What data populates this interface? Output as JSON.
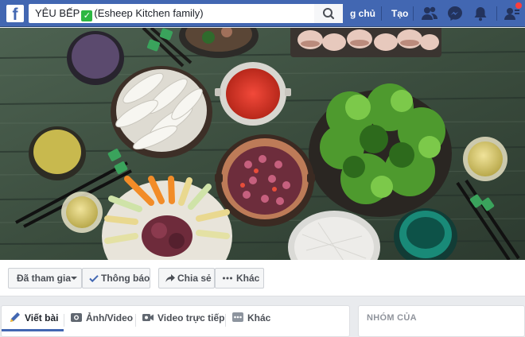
{
  "topbar": {
    "search_value_part1": "YÊU BẾP",
    "search_check": "✓",
    "search_value_part2": "(Esheep Kitchen family)",
    "home_label": "g chủ",
    "create_label": "Tạo"
  },
  "actions": {
    "joined_label": "Đã tham gia",
    "notifications_label": "Thông báo",
    "share_label": "Chia sẻ",
    "more_label": "Khác"
  },
  "composer": {
    "write_label": "Viết bài",
    "photo_label": "Ảnh/Video",
    "live_label": "Video trực tiếp",
    "more_label": "Khác"
  },
  "sidebar": {
    "card_title": "NHÓM CỦA"
  },
  "colors": {
    "brand_blue": "#4267b2",
    "notification_red": "#fa3e3e",
    "check_green": "#2cb742"
  }
}
